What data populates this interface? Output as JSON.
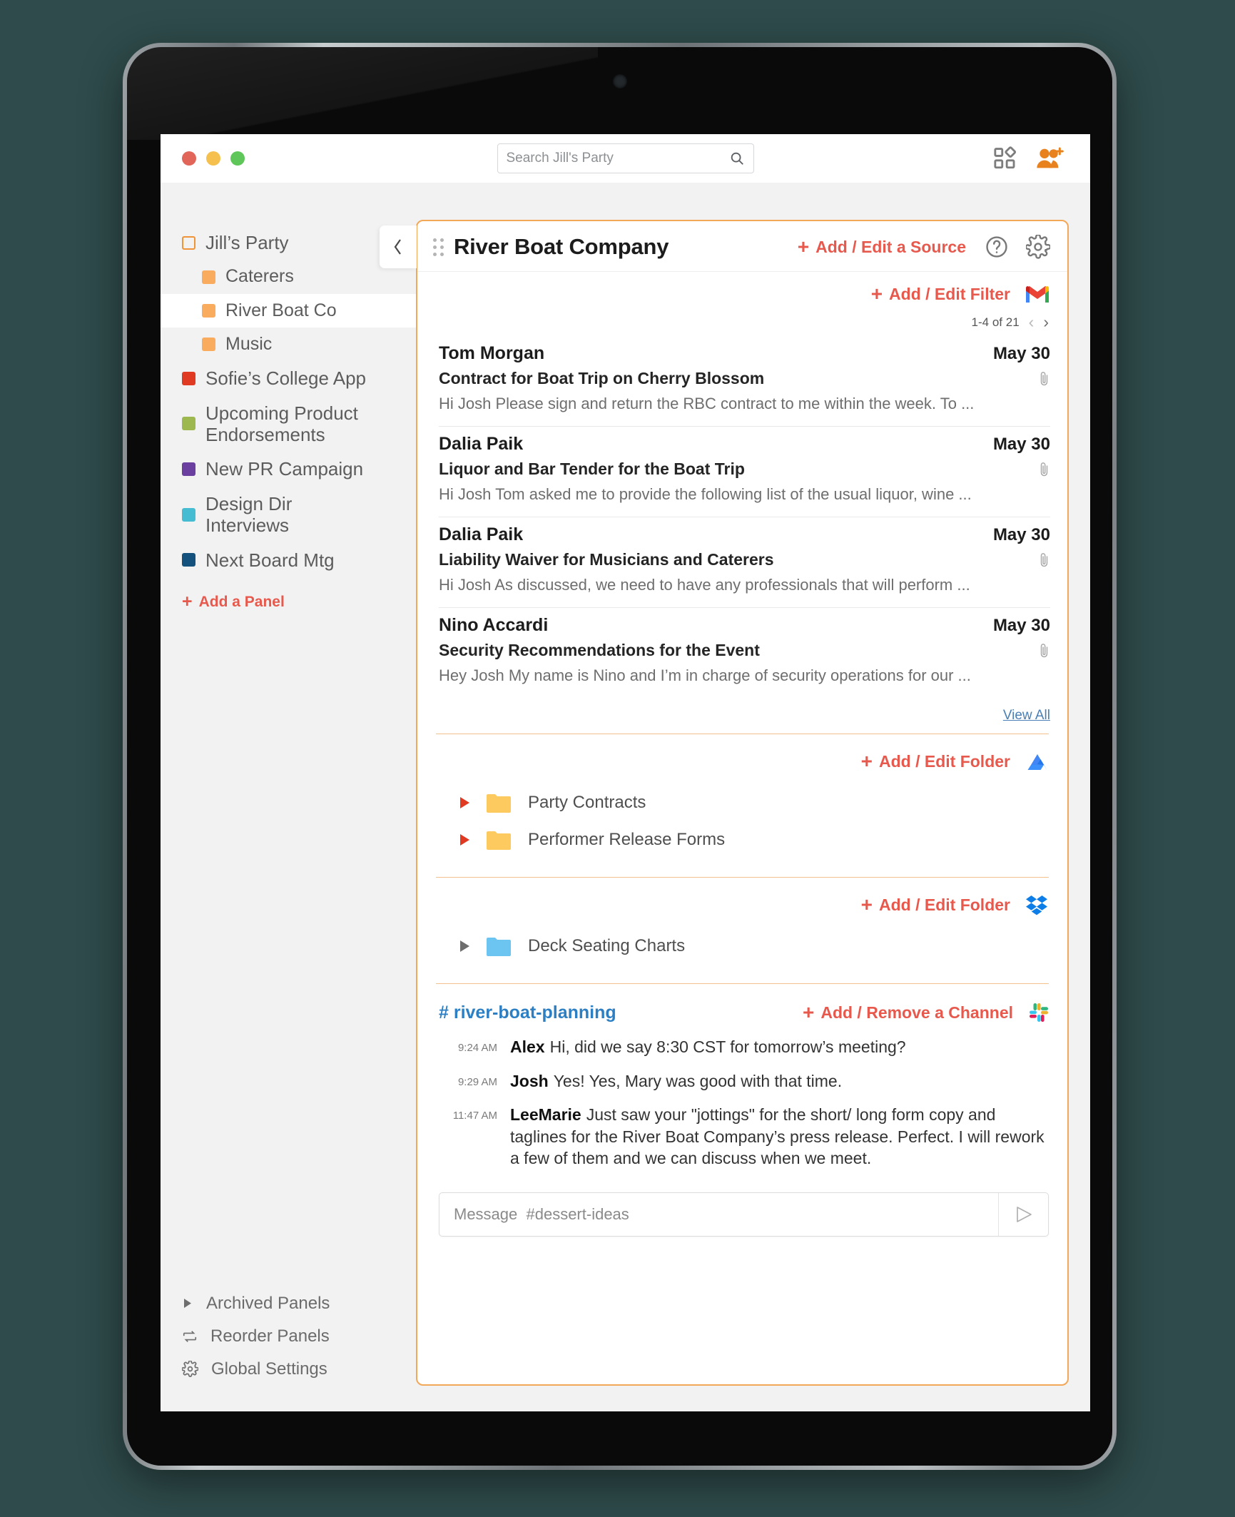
{
  "window": {
    "traffic_lights": [
      "close",
      "minimize",
      "maximize"
    ],
    "search": {
      "placeholder": "Search Jill's Party",
      "value": ""
    },
    "toolbar_icons": [
      "apps-grid-icon",
      "add-people-icon"
    ]
  },
  "sidebar": {
    "collapse_label": "‹",
    "workspace": {
      "label": "Jill’s Party",
      "color": "#f0943a"
    },
    "items": [
      {
        "label": "Caterers",
        "color": "#f9ab5e",
        "sub": true,
        "active": false
      },
      {
        "label": "River Boat Co",
        "color": "#f9ab5e",
        "sub": true,
        "active": true
      },
      {
        "label": "Music",
        "color": "#f9ab5e",
        "sub": true,
        "active": false
      },
      {
        "label": "Sofie’s College App",
        "color": "#e03a22",
        "sub": false,
        "active": false
      },
      {
        "label": "Upcoming Product Endorsements",
        "color": "#9cb84e",
        "sub": false,
        "active": false
      },
      {
        "label": "New PR Campaign",
        "color": "#6b3fa0",
        "sub": false,
        "active": false
      },
      {
        "label": "Design Dir Interviews",
        "color": "#45bcd2",
        "sub": false,
        "active": false
      },
      {
        "label": "Next Board Mtg",
        "color": "#14527d",
        "sub": false,
        "active": false
      }
    ],
    "add_panel": {
      "label": "Add a Panel",
      "plus": "+"
    },
    "bottom": [
      {
        "label": "Archived Panels",
        "icon": "triangle-right-icon"
      },
      {
        "label": "Reorder Panels",
        "icon": "reorder-icon"
      },
      {
        "label": "Global Settings",
        "icon": "gear-icon"
      }
    ]
  },
  "panel": {
    "title": "River Boat Company",
    "drag_handle": "drag-grip-icon",
    "add_source_label": "Add / Edit a Source",
    "help_icon": "help-circle-icon",
    "settings_icon": "gear-icon",
    "mail": {
      "add_filter_label": "Add / Edit Filter",
      "source_icon": "gmail-icon",
      "pager": {
        "range": "1-4 of 21",
        "prev": "‹",
        "next": "›"
      },
      "messages": [
        {
          "from": "Tom Morgan",
          "date": "May 30",
          "subject": "Contract for Boat Trip on Cherry Blossom",
          "preview": "Hi Josh Please sign and return the RBC contract to me within the week. To ...",
          "attachment": true
        },
        {
          "from": "Dalia Paik",
          "date": "May 30",
          "subject": "Liquor and Bar Tender for the Boat Trip",
          "preview": "Hi Josh Tom asked me to provide the following list of the usual liquor, wine ...",
          "attachment": true
        },
        {
          "from": "Dalia Paik",
          "date": "May 30",
          "subject": "Liability Waiver for Musicians and Caterers",
          "preview": "Hi Josh As discussed, we need to have any professionals that will perform ...",
          "attachment": true
        },
        {
          "from": "Nino Accardi",
          "date": "May 30",
          "subject": "Security Recommendations for the Event",
          "preview": "Hey Josh My name is Nino and I’m in charge of security operations for our ...",
          "attachment": true
        }
      ],
      "view_all_label": "View All"
    },
    "drive": {
      "add_folder_label": "Add / Edit Folder",
      "source_icon": "google-drive-icon",
      "folders": [
        {
          "name": "Party Contracts",
          "color": "#fcca5f",
          "arrow": "red"
        },
        {
          "name": "Performer Release Forms",
          "color": "#fcca5f",
          "arrow": "red"
        }
      ]
    },
    "dropbox": {
      "add_folder_label": "Add / Edit Folder",
      "source_icon": "dropbox-icon",
      "folders": [
        {
          "name": "Deck Seating Charts",
          "color": "#6cc5f0",
          "arrow": "grey"
        }
      ]
    },
    "slack": {
      "channel": "# river-boat-planning",
      "add_channel_label": "Add / Remove a Channel",
      "source_icon": "slack-icon",
      "messages": [
        {
          "time": "9:24 AM",
          "user": "Alex",
          "text": "Hi, did we say 8:30 CST for tomorrow’s meeting?"
        },
        {
          "time": "9:29 AM",
          "user": "Josh",
          "text": "Yes! Yes, Mary was good with that time."
        },
        {
          "time": "11:47 AM",
          "user": "LeeMarie",
          "text": "Just saw your \"jottings\" for the short/ long form copy and taglines for the River Boat Company’s press release. Perfect. I will rework a few of them and we can discuss when we meet."
        }
      ],
      "composer": {
        "placeholder": "Message  #dessert-ideas",
        "value": "",
        "send_icon": "send-icon"
      }
    }
  },
  "colors": {
    "accent_red": "#e8594d",
    "panel_border": "#f2a858",
    "link_blue": "#2d7fc4",
    "sidebar_bg": "#f2f2f2"
  }
}
